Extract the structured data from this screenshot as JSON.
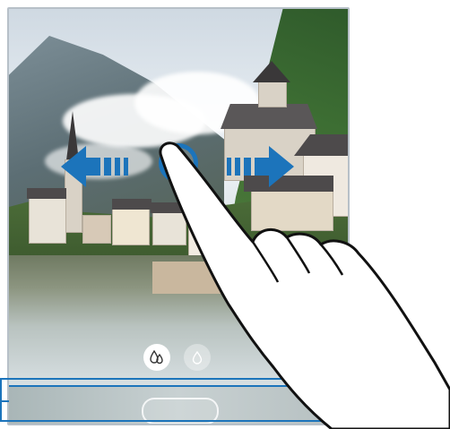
{
  "screen": {
    "mode": "camera-filter-swipe",
    "accent_color": "#1c74bb"
  },
  "gestures": {
    "left_arrow_icon": "arrow-left-icon",
    "right_arrow_icon": "arrow-right-icon",
    "hand_icon": "pointing-hand-icon"
  },
  "filters": {
    "active_icon": "color-tone-drops-icon",
    "inactive_icon": "single-drop-icon"
  },
  "bottom_bar": {
    "pill_icon": "shutter-pill-icon"
  }
}
